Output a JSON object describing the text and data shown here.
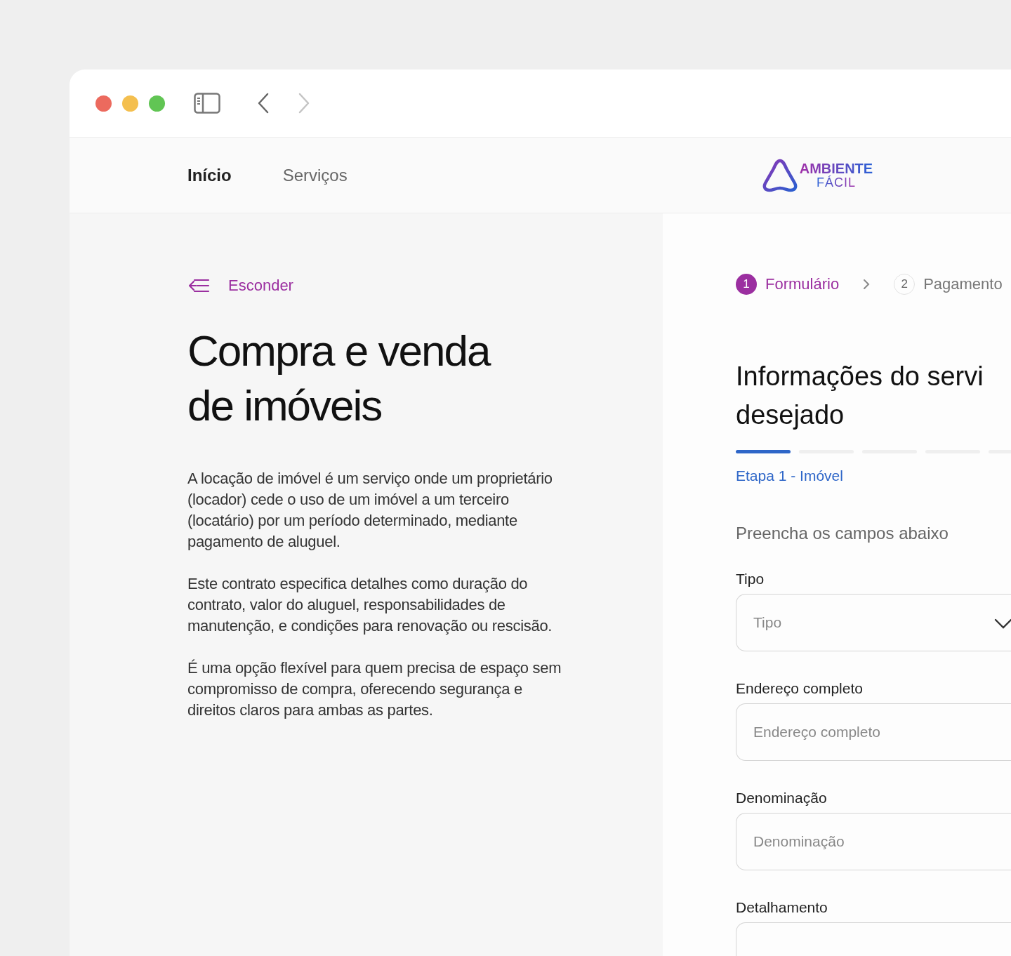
{
  "window": {
    "controls": [
      {
        "color": "#ec6a5e"
      },
      {
        "color": "#f4bf4f"
      },
      {
        "color": "#61c554"
      }
    ],
    "back_disabled": false,
    "forward_disabled": true
  },
  "nav": {
    "items": [
      {
        "label": "Início",
        "selected": true
      },
      {
        "label": "Serviços",
        "selected": false
      }
    ],
    "logo": {
      "line_1": "AMBIENTE",
      "line_2": "FÁCIL"
    }
  },
  "intro": {
    "hide_link": "Esconder",
    "title": "Compra e venda de imóveis",
    "paragraphs": [
      "A locação de imóvel é um serviço onde um proprietário (locador) cede o uso de um imóvel a um terceiro (locatário) por um período determinado, mediante pagamento de aluguel.",
      "Este contrato especifica detalhes como duração do contrato, valor do aluguel, responsabilidades de manutenção, e condições para renovação ou rescisão.",
      "É uma opção flexível para quem precisa de espaço sem compromisso de compra, oferecendo segurança e direitos claros para ambas as partes."
    ]
  },
  "form": {
    "steps": [
      {
        "number": "1",
        "label": "Formulário",
        "selected": true
      },
      {
        "number": "2",
        "label": "Pagamento",
        "selected": false
      }
    ],
    "title_lines": [
      "Informações do servi",
      "desejado"
    ],
    "progress": [
      {
        "done": true
      },
      {
        "done": false
      },
      {
        "done": false
      },
      {
        "done": false
      },
      {
        "done": false
      }
    ],
    "stage": "Etapa 1 - Imóvel",
    "subtitle": "Preencha os campos abaixo",
    "fields": [
      {
        "kind": "select",
        "label": "Tipo",
        "placeholder": "Tipo"
      },
      {
        "kind": "text",
        "label": "Endereço completo",
        "placeholder": "Endereço completo"
      },
      {
        "kind": "text",
        "label": "Denominação",
        "placeholder": "Denominação"
      },
      {
        "kind": "textarea",
        "label": "Detalhamento"
      }
    ]
  }
}
